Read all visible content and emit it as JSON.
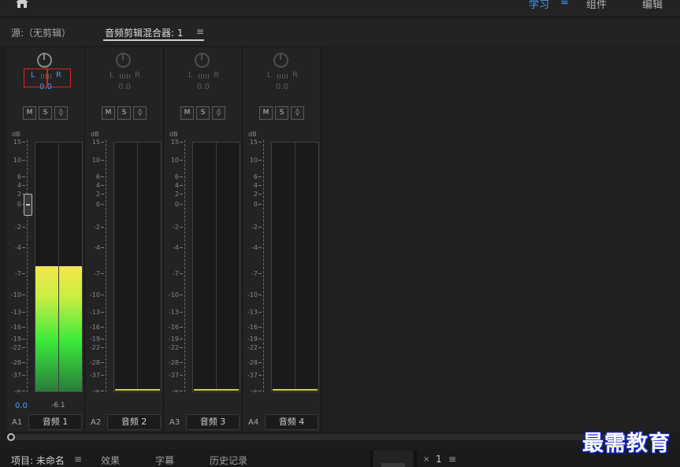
{
  "workspaces": [
    "学习",
    "组件",
    "编辑"
  ],
  "workspace_menu_glyph": "≡",
  "panel": {
    "source_tab": "源:（无剪辑）",
    "mixer_tab": "音频剪辑混合器: 1",
    "menu_glyph": "≡"
  },
  "db_unit": "dB",
  "scale_ticks": [
    "15",
    "10",
    "6",
    "4",
    "2",
    "0",
    "-2",
    "-4",
    "-7",
    "-10",
    "-13",
    "-16",
    "-19",
    "-22",
    "-28",
    "-37",
    "-∞"
  ],
  "channels": [
    {
      "id": "A1",
      "name": "音频 1",
      "pan_l": "L",
      "pan_r": "R",
      "pan_value": "0.0",
      "buttons": [
        "M",
        "S",
        "◊"
      ],
      "volume": "0.0",
      "peak": "-6.1",
      "level_db": -6.1,
      "active": true
    },
    {
      "id": "A2",
      "name": "音频 2",
      "pan_l": "L",
      "pan_r": "R",
      "pan_value": "0.0",
      "buttons": [
        "M",
        "S",
        "◊"
      ],
      "volume": "",
      "peak": "",
      "level_db": null,
      "active": false
    },
    {
      "id": "A3",
      "name": "音频 3",
      "pan_l": "L",
      "pan_r": "R",
      "pan_value": "0.0",
      "buttons": [
        "M",
        "S",
        "◊"
      ],
      "volume": "",
      "peak": "",
      "level_db": null,
      "active": false
    },
    {
      "id": "A4",
      "name": "音频 4",
      "pan_l": "L",
      "pan_r": "R",
      "pan_value": "0.0",
      "buttons": [
        "M",
        "S",
        "◊"
      ],
      "volume": "",
      "peak": "",
      "level_db": null,
      "active": false
    }
  ],
  "bottom": {
    "project_tab": "项目: 未命名",
    "menu_glyph": "≡",
    "effects_tab": "效果",
    "captions_tab": "字幕",
    "history_tab": "历史记录",
    "close_glyph": "×",
    "sequence_tab": "1"
  },
  "watermark": "最需教育",
  "colors": {
    "accent": "#3fa0ff",
    "meter_top": "#f5e74d",
    "meter_green": "#3ae93a",
    "highlight_box": "#e02020"
  }
}
